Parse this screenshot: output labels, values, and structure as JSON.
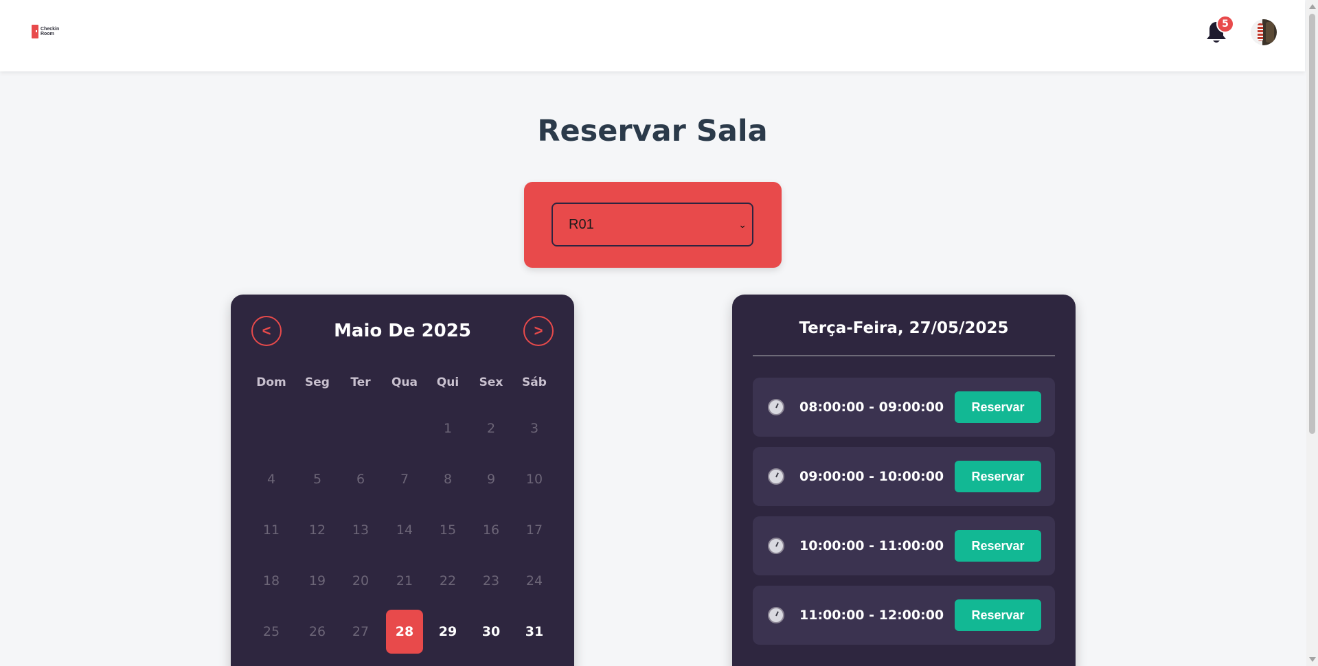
{
  "header": {
    "logo_line1": "Checkin",
    "logo_line2": "Room",
    "notification_count": "5"
  },
  "page": {
    "title": "Reservar Sala"
  },
  "room_select": {
    "value": "R01"
  },
  "calendar": {
    "month_title": "Maio De 2025",
    "prev_label": "<",
    "next_label": ">",
    "weekdays": [
      "Dom",
      "Seg",
      "Ter",
      "Qua",
      "Qui",
      "Sex",
      "Sáb"
    ],
    "first_weekday_index": 4,
    "days_in_month": 31,
    "selected_day": 28,
    "first_available_day": 28
  },
  "slots": {
    "date_title": "Terça-Feira, 27/05/2025",
    "button_label": "Reservar",
    "items": [
      {
        "time": "08:00:00 - 09:00:00"
      },
      {
        "time": "09:00:00 - 10:00:00"
      },
      {
        "time": "10:00:00 - 11:00:00"
      },
      {
        "time": "11:00:00 - 12:00:00"
      }
    ]
  },
  "colors": {
    "accent": "#e84a4b",
    "panel": "#2e263f",
    "slot_bg": "#3b3350",
    "button": "#12b894",
    "page_bg": "#f5f6f8"
  },
  "icons": {
    "notifications": "bell-icon",
    "slot": "clock-icon",
    "dropdown": "chevron-down-icon"
  }
}
